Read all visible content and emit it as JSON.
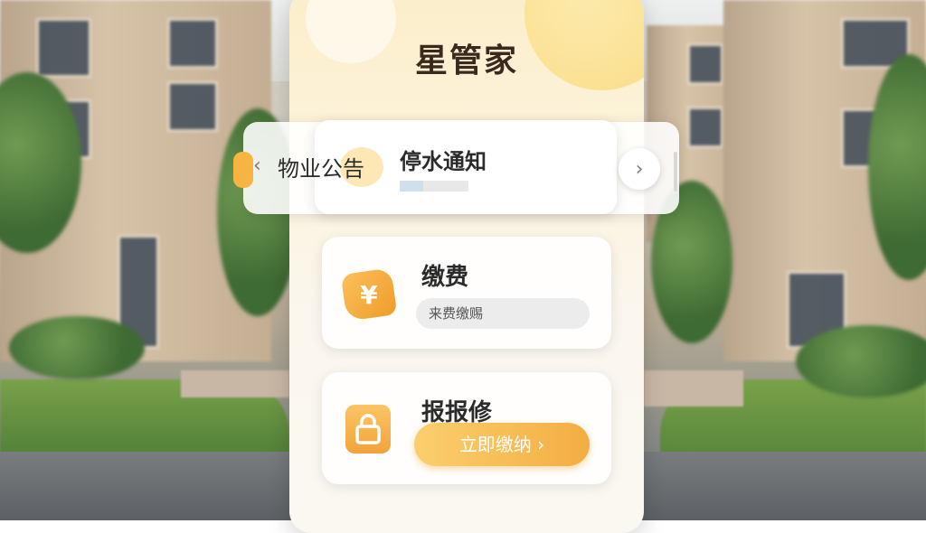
{
  "app": {
    "title": "星管家"
  },
  "notice": {
    "tag": "物业公告",
    "title": "停水通知",
    "prev_icon": "chevron-left-icon",
    "next_icon": "chevron-right-icon"
  },
  "payment": {
    "title": "缴费",
    "icon": "yuan-icon",
    "icon_glyph": "¥",
    "pill_text": "来费缴赐"
  },
  "repair": {
    "title": "报报修",
    "icon": "lock-icon",
    "button_label": "立即缴纳",
    "button_arrow": "›"
  },
  "colors": {
    "accent": "#f3ad42",
    "panel_top": "#fbeeca",
    "text": "#2b2b2b"
  }
}
